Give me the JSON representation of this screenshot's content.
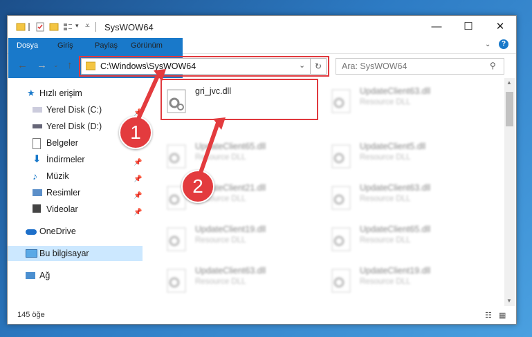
{
  "window": {
    "title": "SysWOW64"
  },
  "ribbon": {
    "tabs": [
      "Dosya",
      "Giriş",
      "Paylaş",
      "Görünüm"
    ]
  },
  "address": {
    "path": "C:\\Windows\\SysWOW64",
    "search_placeholder": "Ara: SysWOW64"
  },
  "nav": {
    "items": [
      {
        "label": "Hızlı erişim",
        "icon": "star-icon",
        "pinned": false
      },
      {
        "label": "Yerel Disk (C:)",
        "icon": "drive-icon",
        "pinned": true
      },
      {
        "label": "Yerel Disk (D:)",
        "icon": "drive-icon",
        "pinned": false
      },
      {
        "label": "Belgeler",
        "icon": "documents-icon",
        "pinned": true
      },
      {
        "label": "İndirmeler",
        "icon": "download-icon",
        "pinned": true
      },
      {
        "label": "Müzik",
        "icon": "music-icon",
        "pinned": true
      },
      {
        "label": "Resimler",
        "icon": "pictures-icon",
        "pinned": true
      },
      {
        "label": "Videolar",
        "icon": "videos-icon",
        "pinned": true
      },
      {
        "label": "OneDrive",
        "icon": "cloud-icon",
        "pinned": false
      },
      {
        "label": "Bu bilgisayar",
        "icon": "computer-icon",
        "pinned": false
      },
      {
        "label": "Ağ",
        "icon": "network-icon",
        "pinned": false
      }
    ]
  },
  "files": {
    "left": [
      {
        "name": "gri_jvc.dll",
        "desc": ""
      },
      {
        "name": "UpdateClient65.dll",
        "desc": "Resource DLL"
      },
      {
        "name": "UpdateClient21.dll",
        "desc": "Resource DLL"
      },
      {
        "name": "UpdateClient19.dll",
        "desc": "Resource DLL"
      },
      {
        "name": "UpdateClient63.dll",
        "desc": "Resource DLL"
      }
    ],
    "right": [
      {
        "name": "UpdateClient63.dll",
        "desc": "Resource DLL"
      },
      {
        "name": "UpdateClient5.dll",
        "desc": "Resource DLL"
      },
      {
        "name": "UpdateClient63.dll",
        "desc": "Resource DLL"
      },
      {
        "name": "UpdateClient65.dll",
        "desc": "Resource DLL"
      },
      {
        "name": "UpdateClient19.dll",
        "desc": "Resource DLL"
      }
    ]
  },
  "status": {
    "count": "145 öğe"
  },
  "callouts": [
    "1",
    "2"
  ],
  "colors": {
    "accent": "#1979ca",
    "highlight": "#e0393e",
    "selection": "#cce8ff"
  }
}
